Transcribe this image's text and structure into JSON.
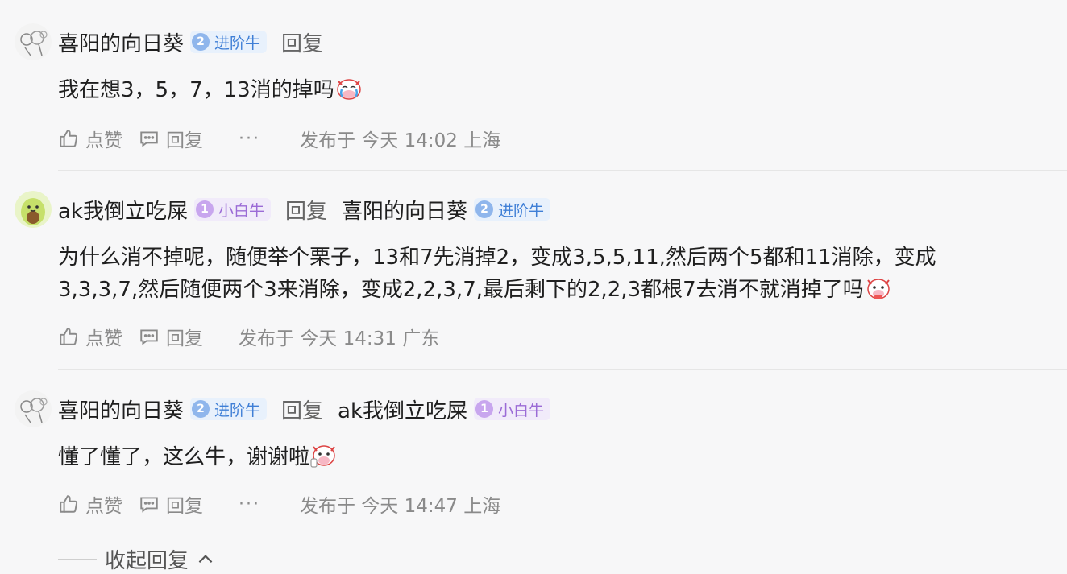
{
  "comments": [
    {
      "user": "喜阳的向日葵",
      "badge": {
        "level": "2",
        "label": "进阶牛"
      },
      "reply_label": "回复",
      "text": "我在想3，5，7，13消的掉吗",
      "emoji": "crying-cow-emoji",
      "actions": {
        "like": "点赞",
        "reply": "回复",
        "more": "···"
      },
      "meta": "发布于  今天 14:02 上海"
    },
    {
      "user": "ak我倒立吃屎",
      "badge": {
        "level": "1",
        "label": "小白牛"
      },
      "reply_label": "回复",
      "reply_to": {
        "user": "喜阳的向日葵",
        "badge": {
          "level": "2",
          "label": "进阶牛"
        }
      },
      "text_line1": "为什么消不掉呢，随便举个栗子，13和7先消掉2，变成3,5,5,11,然后两个5都和11消除，变成",
      "text_line2": "3,3,3,7,然后随便两个3来消除，变成2,2,3,7,最后剩下的2,2,3都根7去消不就消掉了吗",
      "emoji": "cow-emoji",
      "actions": {
        "like": "点赞",
        "reply": "回复"
      },
      "meta": "发布于  今天 14:31 广东"
    },
    {
      "user": "喜阳的向日葵",
      "badge": {
        "level": "2",
        "label": "进阶牛"
      },
      "reply_label": "回复",
      "reply_to": {
        "user": "ak我倒立吃屎",
        "badge": {
          "level": "1",
          "label": "小白牛"
        }
      },
      "text": "懂了懂了，这么牛，谢谢啦",
      "emoji": "thumbs-up-cow-emoji",
      "actions": {
        "like": "点赞",
        "reply": "回复",
        "more": "···"
      },
      "meta": "发布于  今天 14:47 上海"
    }
  ],
  "collapse_label": "收起回复",
  "colors": {
    "advanced_badge": "#3f7fd6",
    "novice_badge": "#9b6bd6",
    "muted_text": "#8a8a8a"
  }
}
